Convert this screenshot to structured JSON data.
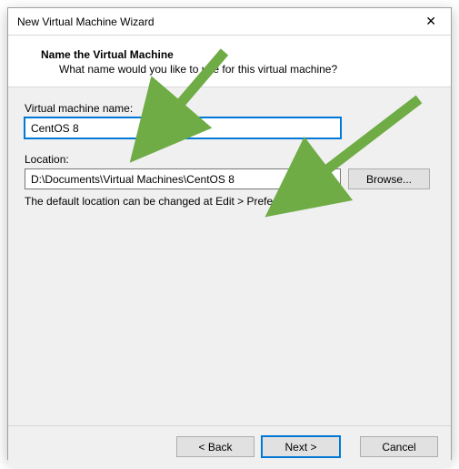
{
  "titlebar": {
    "title": "New Virtual Machine Wizard"
  },
  "header": {
    "title": "Name the Virtual Machine",
    "subtitle": "What name would you like to use for this virtual machine?"
  },
  "fields": {
    "vm_name_label": "Virtual machine name:",
    "vm_name_value": "CentOS 8",
    "location_label": "Location:",
    "location_value": "D:\\Documents\\Virtual Machines\\CentOS 8",
    "browse_label": "Browse..."
  },
  "hint": "The default location can be changed at Edit > Preferences.",
  "footer": {
    "back": "< Back",
    "next": "Next >",
    "cancel": "Cancel"
  },
  "annotations": {
    "arrow_color": "#6fac46"
  }
}
